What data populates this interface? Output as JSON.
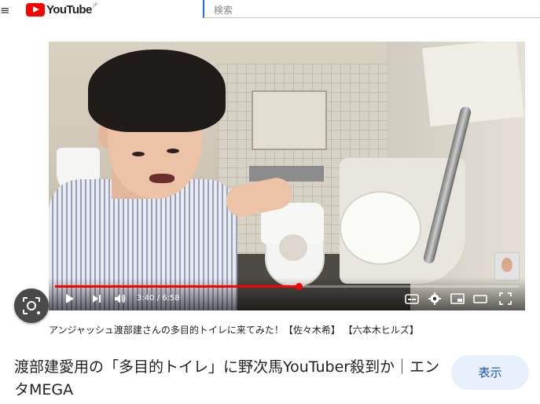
{
  "topbar": {
    "menu_glyph": "≡",
    "logo_text": "YouTube",
    "logo_region": "JP",
    "search_placeholder": "検索"
  },
  "video": {
    "current_time": "3:40",
    "duration": "6:58",
    "time_label": "3:40 / 6:58",
    "progress_fraction": 0.526,
    "controls": [
      "play-icon",
      "next-icon",
      "volume-icon",
      "subtitles-icon",
      "settings-icon",
      "miniplayer-icon",
      "theater-icon",
      "fullscreen-icon"
    ],
    "caption": "アンジャッシュ渡部建さんの多目的トイレに来てみた！【佐々木希】 【六本木ヒルズ】"
  },
  "result": {
    "headline": "渡部建愛用の「多目的トイレ」に野次馬YouTuber殺到か｜エンタMEGA",
    "view_button": "表示"
  },
  "colors": {
    "yt_red": "#ff0000",
    "view_button_bg": "#e8f0fe",
    "view_button_text": "#1a55c5",
    "search_focus": "#1a73e8"
  }
}
